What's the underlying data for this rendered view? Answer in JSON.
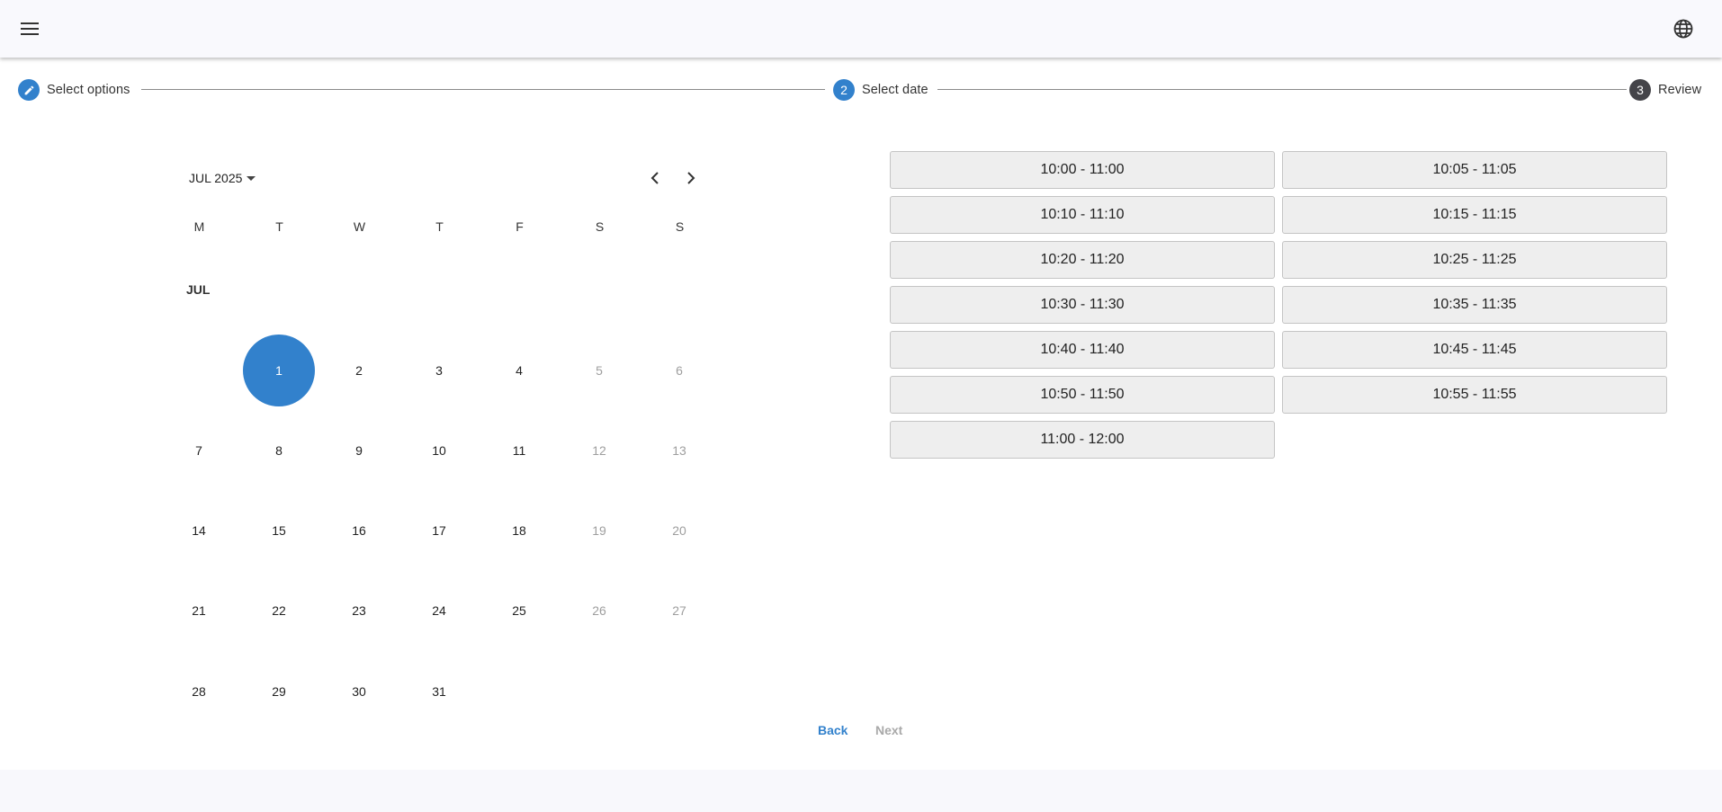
{
  "header": {
    "menu_icon": "menu-icon",
    "language_icon": "globe-icon"
  },
  "stepper": {
    "steps": [
      {
        "label": "Select options",
        "marker": "pencil-icon",
        "state": "completed"
      },
      {
        "label": "Select date",
        "marker": "2",
        "state": "active"
      },
      {
        "label": "Review",
        "marker": "3",
        "state": "upcoming"
      }
    ],
    "colors": {
      "active": "#3281cc",
      "upcoming": "#444449"
    }
  },
  "calendar": {
    "period_label": "JUL 2025",
    "prev_icon": "chevron-left-icon",
    "next_icon": "chevron-right-icon",
    "weekdays": [
      "M",
      "T",
      "W",
      "T",
      "F",
      "S",
      "S"
    ],
    "month_label": "JUL",
    "selected_day": "1",
    "weeks": [
      [
        "",
        "1",
        "2",
        "3",
        "4",
        "5",
        "6"
      ],
      [
        "7",
        "8",
        "9",
        "10",
        "11",
        "12",
        "13"
      ],
      [
        "14",
        "15",
        "16",
        "17",
        "18",
        "19",
        "20"
      ],
      [
        "21",
        "22",
        "23",
        "24",
        "25",
        "26",
        "27"
      ],
      [
        "28",
        "29",
        "30",
        "31",
        "",
        "",
        ""
      ]
    ],
    "disabled_columns": [
      5,
      6
    ]
  },
  "time_slots": [
    "10:00 - 11:00",
    "10:05 - 11:05",
    "10:10 - 11:10",
    "10:15 - 11:15",
    "10:20 - 11:20",
    "10:25 - 11:25",
    "10:30 - 11:30",
    "10:35 - 11:35",
    "10:40 - 11:40",
    "10:45 - 11:45",
    "10:50 - 11:50",
    "10:55 - 11:55",
    "11:00 - 12:00"
  ],
  "actions": {
    "back_label": "Back",
    "next_label": "Next",
    "back_color": "#3281cc",
    "next_color": "#a9a9a9"
  }
}
